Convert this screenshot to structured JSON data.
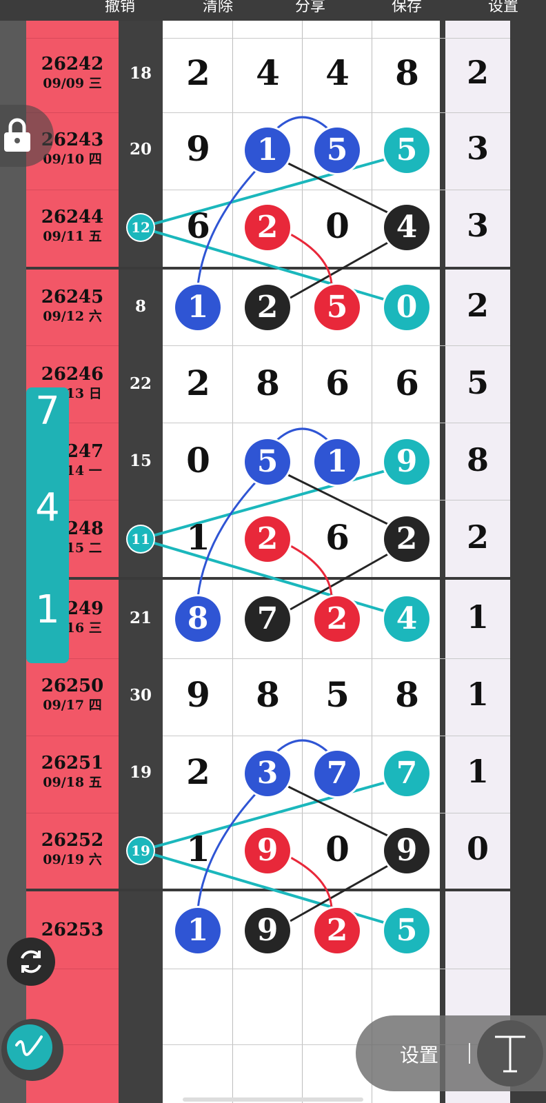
{
  "toolbar": {
    "undo": "撤销",
    "clear": "清除",
    "share": "分享",
    "save": "保存",
    "settings": "设置"
  },
  "rows": [
    {
      "issue": "26242",
      "date": "09/09 三",
      "sum": "18",
      "digits": [
        "2",
        "4",
        "4",
        "8"
      ],
      "extra": "2"
    },
    {
      "issue": "26243",
      "date": "09/10 四",
      "sum": "20",
      "digits": [
        "9",
        "1",
        "5",
        "5"
      ],
      "extra": "3"
    },
    {
      "issue": "26244",
      "date": "09/11 五",
      "sum": "",
      "digits": [
        "6",
        "2",
        "0",
        "4"
      ],
      "extra": "3"
    },
    {
      "issue": "26245",
      "date": "09/12 六",
      "sum": "8",
      "digits": [
        "1",
        "2",
        "5",
        "0"
      ],
      "extra": "2"
    },
    {
      "issue": "26246",
      "date": "09/13 日",
      "sum": "22",
      "digits": [
        "2",
        "8",
        "6",
        "6"
      ],
      "extra": "5"
    },
    {
      "issue": "26247",
      "date": "09/14 一",
      "sum": "15",
      "digits": [
        "0",
        "5",
        "1",
        "9"
      ],
      "extra": "8"
    },
    {
      "issue": "26248",
      "date": "09/15 二",
      "sum": "",
      "digits": [
        "1",
        "2",
        "6",
        "2"
      ],
      "extra": "2"
    },
    {
      "issue": "26249",
      "date": "09/16 三",
      "sum": "21",
      "digits": [
        "8",
        "7",
        "2",
        "4"
      ],
      "extra": "1"
    },
    {
      "issue": "26250",
      "date": "09/17 四",
      "sum": "30",
      "digits": [
        "9",
        "8",
        "5",
        "8"
      ],
      "extra": "1"
    },
    {
      "issue": "26251",
      "date": "09/18 五",
      "sum": "19",
      "digits": [
        "2",
        "3",
        "7",
        "7"
      ],
      "extra": "1"
    },
    {
      "issue": "26252",
      "date": "09/19 六",
      "sum": "",
      "digits": [
        "1",
        "9",
        "0",
        "9"
      ],
      "extra": "0"
    },
    {
      "issue": "26253",
      "date": "",
      "sum": "",
      "digits": [
        "1",
        "9",
        "2",
        "5"
      ],
      "extra": ""
    }
  ],
  "markers": [
    "12",
    "11",
    "19"
  ],
  "side_panel": [
    "7",
    "4",
    "1"
  ],
  "bottom": {
    "settings_label": "设置"
  },
  "colors": {
    "red_panel": "#f25767",
    "blue": "#2f55d4",
    "red": "#e8283a",
    "black": "#252525",
    "teal": "#1bb7bc"
  },
  "icons": [
    "lock-icon",
    "refresh-icon",
    "pen-icon",
    "text-cursor-icon"
  ]
}
